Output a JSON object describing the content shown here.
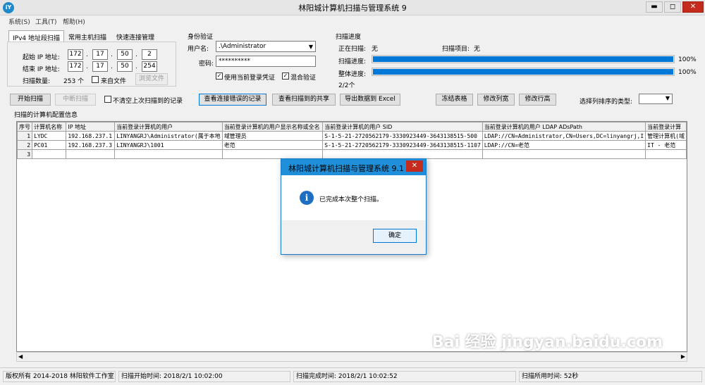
{
  "window": {
    "title": "林阳城计算机扫描与管理系统 9",
    "icon": "iY",
    "controls": {
      "minimize": "▬",
      "maximize": "◻",
      "close": "✕"
    }
  },
  "menu": [
    "系统(S)",
    "工具(T)",
    "帮助(H)"
  ],
  "tabs": [
    "IPv4 地址段扫描",
    "常用主机扫描",
    "快速连接管理"
  ],
  "ip": {
    "start_label": "起始 IP 地址:",
    "end_label": "结束 IP 地址:",
    "start": [
      "172",
      "17",
      "50",
      "2"
    ],
    "end": [
      "172",
      "17",
      "50",
      "254"
    ],
    "count_label": "扫描数量:",
    "count": "253 个",
    "from_file": "来自文件",
    "browse": "浏览文件"
  },
  "auth": {
    "title": "身份验证",
    "user_label": "用户名:",
    "user": ".\\Administrator",
    "pass_label": "密码:",
    "pass": "**********",
    "use_current": "使用当前登录凭证",
    "mixed": "混合验证"
  },
  "progress": {
    "title": "扫描进度",
    "scanning_label": "正在扫描:",
    "scanning_value": "无",
    "item_label": "扫描项目:",
    "item_value": "无",
    "scan_label": "扫描进度:",
    "scan_pct": "100%",
    "scan_value": 1.0,
    "total_label": "整体进度:",
    "total_pct": "100%",
    "total_value": 1.0,
    "count": "2/2个"
  },
  "toolbar": {
    "start": "开始扫描",
    "stop": "中断扫描",
    "keep": "不清空上次扫描到的记录",
    "errors": "查看连接错误的记录",
    "shares": "查看扫描到的共享",
    "export": "导出数据到 Excel",
    "freeze": "冻结表格",
    "col_width": "修改列宽",
    "row_height": "修改行高",
    "sort_label": "选择列排序的类型:"
  },
  "grid": {
    "section_title": "扫描的计算机配置信息",
    "headers": [
      "序号",
      "计算机名称",
      "IP 地址",
      "当前登录计算机的用户",
      "当前登录计算机的用户显示名称或全名",
      "当前登录计算机的用户 SID",
      "当前登录计算机的用户 LDAP ADsPath",
      "当前登录计算"
    ],
    "rows": [
      [
        "1",
        "LYDC",
        "192.168.237.1",
        "LINYANGRJ\\Administrator(属于本地",
        "域管理员",
        "S-1-5-21-2720562179-3330923449-3643138515-500",
        "LDAP://CN=Administrator,CN=Users,DC=linyangrj,I",
        "管理计算机(域"
      ],
      [
        "2",
        "PC01",
        "192.168.237.3",
        "LINYANGRJ\\1001",
        "老范",
        "S-1-5-21-2720562179-3330923449-3643138515-1107",
        "LDAP://CN=老范",
        "IT - 老范"
      ],
      [
        "3",
        "",
        "",
        "",
        "",
        "",
        "",
        ""
      ]
    ]
  },
  "dialog": {
    "title": "林阳城计算机扫描与管理系统 9.1",
    "message": "已完成本次整个扫描。",
    "ok": "确定",
    "close": "✕"
  },
  "status": {
    "copyright": "版权所有 2014-2018 林阳软件工作室",
    "start": "扫描开始时间: 2018/2/1 10:02:00",
    "end": "扫描完成时间: 2018/2/1 10:02:52",
    "elapsed": "扫描所用时间: 52秒"
  },
  "watermark": "Bai 经验 jingyan.baidu.com"
}
